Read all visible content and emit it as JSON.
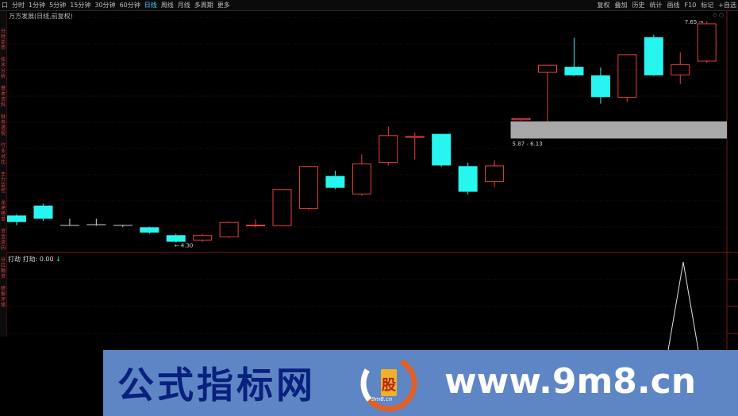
{
  "toolbar": {
    "left": [
      "口",
      "分时",
      "1分钟",
      "5分钟",
      "15分钟",
      "30分钟",
      "60分钟",
      "日线",
      "周线",
      "月线",
      "多周期",
      "更多"
    ],
    "active_index": 7,
    "right": [
      "复权",
      "叠加",
      "历史",
      "统计",
      "画线",
      "F10",
      "标记",
      "+自选"
    ]
  },
  "sidebar": {
    "items": [
      "分时走势",
      "技术分析",
      "基本资料",
      "财务透视",
      "行业对比",
      "主力监控",
      "龙虎榜单",
      "资金流向",
      "分红融资",
      "研报评级"
    ]
  },
  "chart": {
    "title": "万方发展(日线,前复权)",
    "high_label": "7.65",
    "low_label": "← 4.30",
    "zone_label": "5.87 - 6.13",
    "colors": {
      "up": "#e84040",
      "down": "#27f5f0",
      "doji": "#cfcfcf",
      "zone": "#a8a8a8"
    }
  },
  "indicator": {
    "title": "打劫  打劫: 0.00",
    "arrow": "↓"
  },
  "candles": [
    {
      "o": 4.7,
      "c": 4.6,
      "h": 4.72,
      "l": 4.55
    },
    {
      "o": 4.85,
      "c": 4.65,
      "h": 4.88,
      "l": 4.62
    },
    {
      "o": 4.55,
      "c": 4.55,
      "h": 4.65,
      "l": 4.55
    },
    {
      "o": 4.55,
      "c": 4.56,
      "h": 4.65,
      "l": 4.54
    },
    {
      "o": 4.55,
      "c": 4.54,
      "h": 4.56,
      "l": 4.52
    },
    {
      "o": 4.52,
      "c": 4.44,
      "h": 4.53,
      "l": 4.42
    },
    {
      "o": 4.4,
      "c": 4.3,
      "h": 4.42,
      "l": 4.29
    },
    {
      "o": 4.32,
      "c": 4.4,
      "h": 4.42,
      "l": 4.3
    },
    {
      "o": 4.37,
      "c": 4.6,
      "h": 4.61,
      "l": 4.36
    },
    {
      "o": 4.54,
      "c": 4.56,
      "h": 4.64,
      "l": 4.52
    },
    {
      "o": 4.54,
      "c": 5.1,
      "h": 5.1,
      "l": 4.54
    },
    {
      "o": 4.8,
      "c": 5.45,
      "h": 5.45,
      "l": 4.78
    },
    {
      "o": 5.3,
      "c": 5.12,
      "h": 5.38,
      "l": 5.1
    },
    {
      "o": 5.02,
      "c": 5.49,
      "h": 5.63,
      "l": 5.0
    },
    {
      "o": 5.5,
      "c": 5.92,
      "h": 6.05,
      "l": 5.46
    },
    {
      "o": 5.88,
      "c": 5.91,
      "h": 5.96,
      "l": 5.55
    },
    {
      "o": 5.94,
      "c": 5.46,
      "h": 5.94,
      "l": 5.44
    },
    {
      "o": 5.45,
      "c": 5.06,
      "h": 5.5,
      "l": 5.02
    },
    {
      "o": 5.21,
      "c": 5.46,
      "h": 5.54,
      "l": 5.13
    },
    {
      "o": 6.15,
      "c": 6.18,
      "h": 6.18,
      "l": 6.14
    },
    {
      "o": 6.87,
      "c": 6.99,
      "h": 6.99,
      "l": 5.88
    },
    {
      "o": 6.96,
      "c": 6.83,
      "h": 7.4,
      "l": 6.82
    },
    {
      "o": 6.83,
      "c": 6.5,
      "h": 6.95,
      "l": 6.4
    },
    {
      "o": 6.49,
      "c": 7.15,
      "h": 7.15,
      "l": 6.42
    },
    {
      "o": 7.41,
      "c": 6.83,
      "h": 7.45,
      "l": 6.82
    },
    {
      "o": 6.83,
      "c": 7.0,
      "h": 7.18,
      "l": 6.7
    },
    {
      "o": 7.04,
      "c": 7.62,
      "h": 7.65,
      "l": 7.02
    }
  ],
  "banner": {
    "cn_text": "公式指标网",
    "url_text": "www.9m8.cn",
    "logo_text": "9m8.cn",
    "logo_char": "股"
  }
}
